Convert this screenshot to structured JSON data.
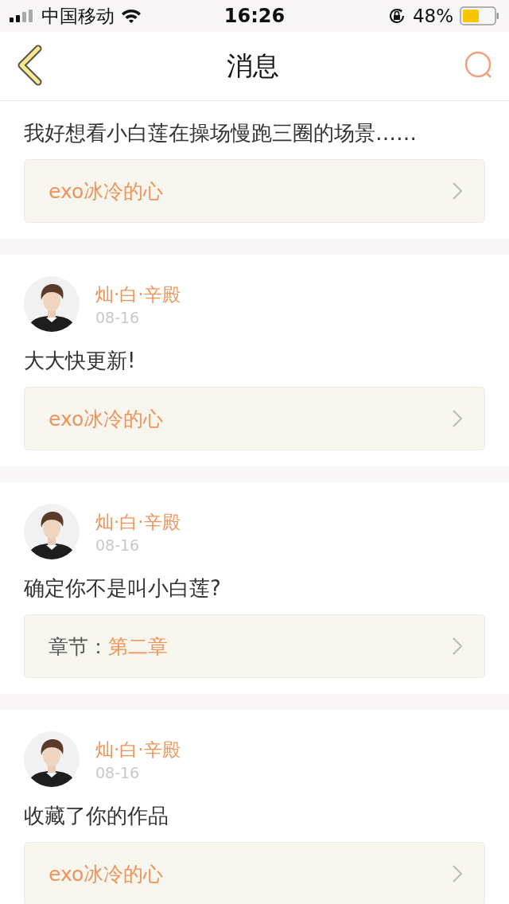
{
  "status_bar": {
    "carrier": "中国移动",
    "time": "16:26",
    "battery": "48%"
  },
  "nav": {
    "title": "消息"
  },
  "messages": [
    {
      "text": "我好想看小白莲在操场慢跑三圈的场景……",
      "link": {
        "kind": "work",
        "title": "exo冰冷的心"
      }
    },
    {
      "author": {
        "name": "灿·白·辛殿",
        "date": "08-16"
      },
      "text": "大大快更新!",
      "link": {
        "kind": "work",
        "title": "exo冰冷的心"
      }
    },
    {
      "author": {
        "name": "灿·白·辛殿",
        "date": "08-16"
      },
      "text": "确定你不是叫小白莲?",
      "link": {
        "kind": "chapter",
        "label": "章节：",
        "title": "第二章"
      }
    },
    {
      "author": {
        "name": "灿·白·辛殿",
        "date": "08-16"
      },
      "text": "收藏了你的作品",
      "link": {
        "kind": "work",
        "title": "exo冰冷的心"
      }
    }
  ]
}
